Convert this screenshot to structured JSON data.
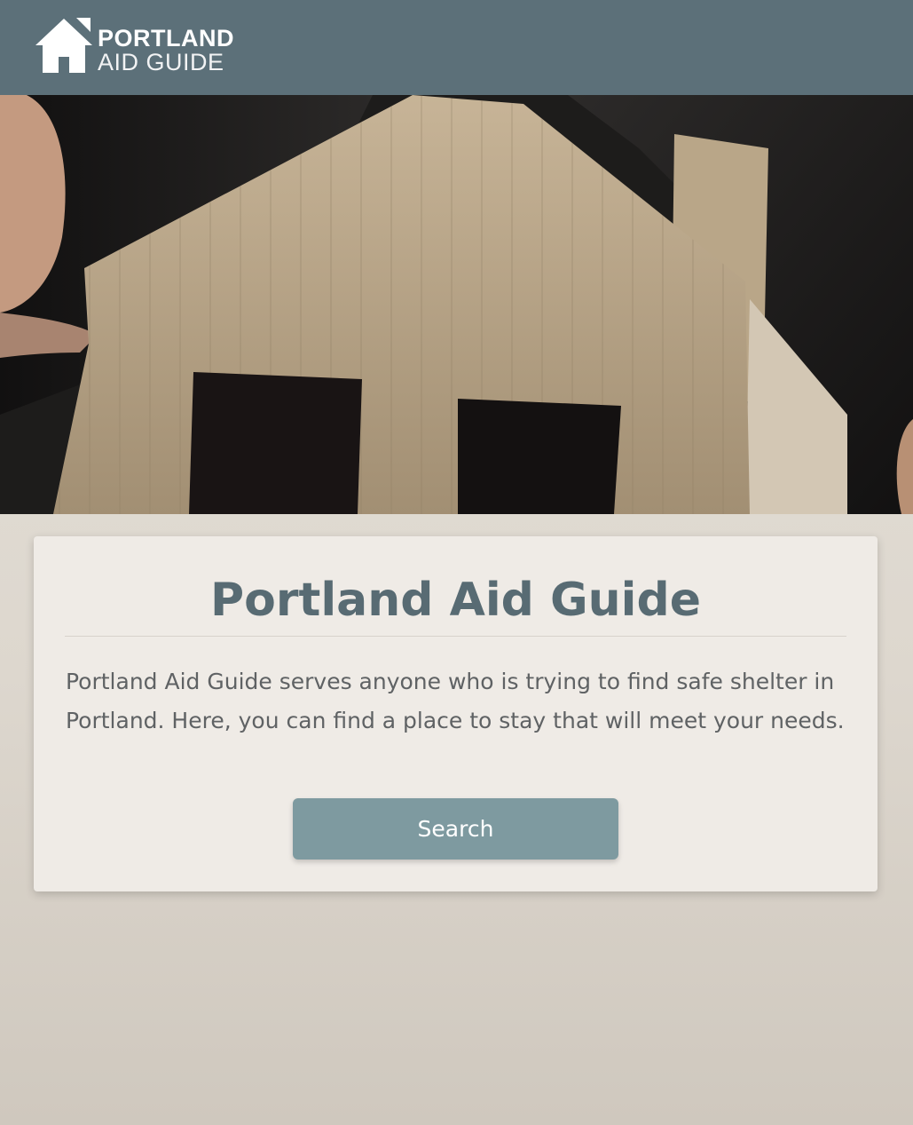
{
  "header": {
    "logo_line1": "PORTLAND",
    "logo_line2": "AID GUIDE",
    "logo_icon": "house-icon"
  },
  "hero": {
    "image": "cardboard-house-photo"
  },
  "main": {
    "title": "Portland Aid Guide",
    "description": "Portland Aid Guide serves anyone who is trying to find safe shelter in Portland. Here, you can find a place to stay that will meet your needs.",
    "search_label": "Search"
  },
  "colors": {
    "header_bg": "#5c7079",
    "title": "#586b73",
    "button": "#7e9aa0",
    "card": "#efebe6"
  }
}
